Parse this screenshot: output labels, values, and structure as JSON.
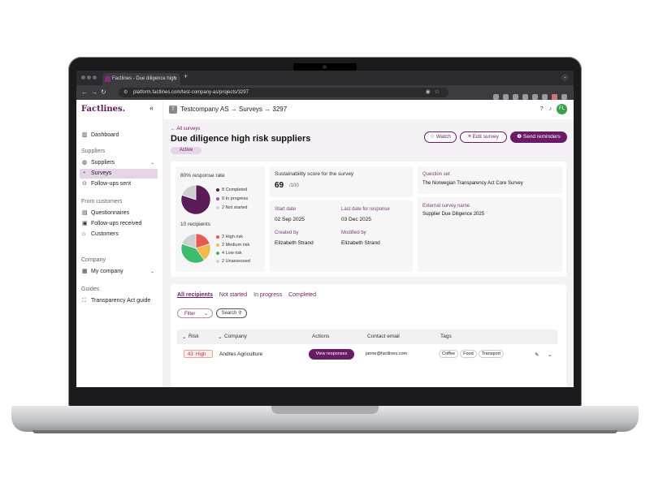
{
  "browser": {
    "tab_title": "Factlines - Due diligence high",
    "url": "platform.factlines.com/test-company-as/projects/3297"
  },
  "sidebar": {
    "logo": "Factlines.",
    "collapse_icon": "«",
    "dashboard": "Dashboard",
    "suppliers_group": "Suppliers",
    "suppliers": "Suppliers",
    "surveys": "Surveys",
    "followups_sent": "Follow-ups sent",
    "customers_group": "From customers",
    "questionnaires": "Questionnaires",
    "followups_received": "Follow-ups received",
    "customers": "Customers",
    "company_group": "Company",
    "my_company": "My company",
    "guides_group": "Guides",
    "transparency_guide": "Transparency Act guide"
  },
  "topbar": {
    "badge": "T",
    "breadcrumb": "Testcompany AS → Surveys → 3297",
    "avatar": "FL"
  },
  "page": {
    "back": "← All surveys",
    "title": "Due diligence high risk suppliers",
    "status": "Active",
    "watch": "☆ Watch",
    "edit": "≡ Edit survey",
    "send": "❷ Send reminders"
  },
  "summary": {
    "response_rate": "80% response rate",
    "completed": "8 Completed",
    "in_progress": "0 In progress",
    "not_started": "2 Not started",
    "recipients": "10 recipients",
    "high_risk": "2 High risk",
    "medium_risk": "2 Medium risk",
    "low_risk": "4 Low risk",
    "unassessed": "2 Unassessed",
    "score_label": "Sustainability score for the survey",
    "score_value": "69",
    "score_max": "/100",
    "start_label": "Start date",
    "start_value": "02 Sep 2025",
    "last_label": "Last date for response",
    "last_value": "03 Dec 2025",
    "created_label": "Created by",
    "created_value": "Elizabeth Strand",
    "modified_label": "Modified by",
    "modified_value": "Elizabeth Strand",
    "qset_label": "Question set",
    "qset_value": "The Norwegian Transparency Act Core Survey",
    "ext_label": "External survey name",
    "ext_value": "Supplier Due Diligence 2025",
    "response_chart": [
      {
        "label": "Completed",
        "value": 8,
        "color": "#5b1b58"
      },
      {
        "label": "In progress",
        "value": 0,
        "color": "#a05a9b"
      },
      {
        "label": "Not started",
        "value": 2,
        "color": "#cfcfd2"
      }
    ],
    "risk_chart": [
      {
        "label": "High risk",
        "value": 2,
        "color": "#e85a4f"
      },
      {
        "label": "Medium risk",
        "value": 2,
        "color": "#f2b84b"
      },
      {
        "label": "Low risk",
        "value": 4,
        "color": "#3dbb6e"
      },
      {
        "label": "Unassessed",
        "value": 2,
        "color": "#cfcfd2"
      }
    ]
  },
  "recipients": {
    "tabs": [
      "All recipients",
      "Not started",
      "In progress",
      "Completed"
    ],
    "filter": "Filter",
    "search": "Search",
    "headers": {
      "risk": "Risk",
      "company": "Company",
      "actions": "Actions",
      "email": "Contact email",
      "tags": "Tags"
    },
    "rows": [
      {
        "risk_score": "43",
        "risk_level": "High",
        "company": "Andres Agriculture",
        "action": "View responses",
        "email": "janne@factlines.com",
        "tags": [
          "Coffee",
          "Food",
          "Transport"
        ]
      }
    ]
  }
}
